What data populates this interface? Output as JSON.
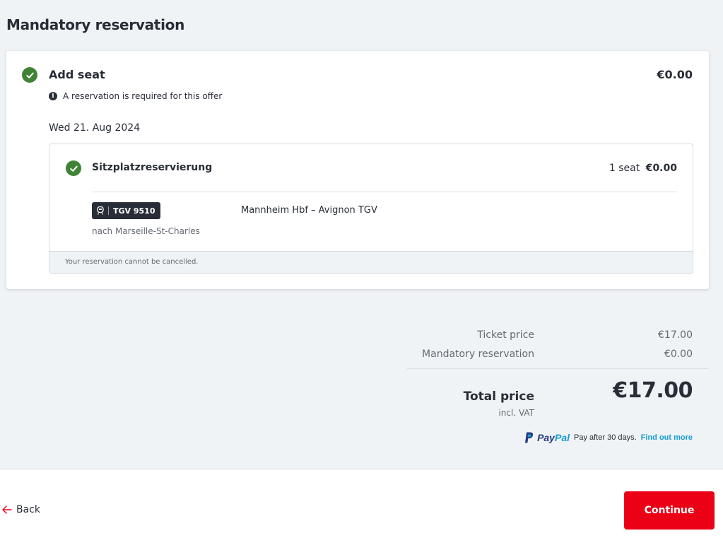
{
  "section": {
    "title": "Mandatory reservation"
  },
  "add_seat": {
    "label": "Add seat",
    "price": "€0.00",
    "info": "A reservation is required for this offer",
    "date": "Wed 21. Aug 2024"
  },
  "reservation": {
    "title": "Sitzplatzreservierung",
    "seat_count": "1 seat",
    "seat_price": "€0.00",
    "train": "TGV 9510",
    "route": "Mannheim Hbf  –  Avignon TGV",
    "destination": "nach Marseille-St-Charles",
    "cancel_note": "Your reservation cannot be cancelled."
  },
  "summary": {
    "ticket_label": "Ticket price",
    "ticket_value": "€17.00",
    "mandatory_label": "Mandatory reservation",
    "mandatory_value": "€0.00",
    "total_label": "Total price",
    "vat_note": "incl. VAT",
    "total_value": "€17.00"
  },
  "paypal": {
    "brand_pay": "Pay",
    "brand_pal": "Pal",
    "text": "Pay after 30 days.",
    "link": "Find out more"
  },
  "footer": {
    "back_label": "Back",
    "continue_label": "Continue"
  },
  "colors": {
    "accent_red": "#ec0016",
    "success_green": "#408335",
    "background": "#f0f3f5",
    "text": "#282d37",
    "paypal_dark": "#253b80",
    "paypal_light": "#179bd7"
  },
  "icons": [
    "check-circle-icon",
    "info-icon",
    "train-icon",
    "paypal-logo-icon",
    "arrow-left-icon"
  ]
}
